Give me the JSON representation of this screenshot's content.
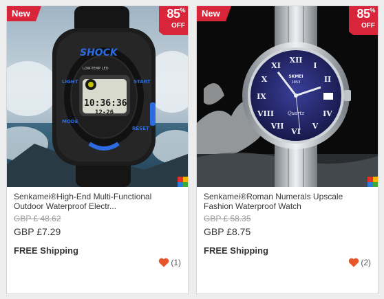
{
  "products": [
    {
      "badge_new": "New",
      "discount_pct": "85",
      "discount_sup": "%",
      "discount_word": "OFF",
      "title": "Senkamei®High-End Multi-Functional Outdoor Waterproof Electr...",
      "old_price": "GBP £ 48.62",
      "price": "GBP £7.29",
      "shipping": "FREE Shipping",
      "fav_count": "(1)",
      "watch_brand": "SHOCK",
      "watch_time": "10:36:36",
      "watch_date": "12-26",
      "watch_side_left": "LIGHT",
      "watch_side_right": "START",
      "watch_side_left2": "MODE",
      "watch_side_right2": "RESET",
      "watch_small": "LOW-TEMP LED"
    },
    {
      "badge_new": "New",
      "discount_pct": "85",
      "discount_sup": "%",
      "discount_word": "OFF",
      "title": "Senkamei®Roman Numerals Upscale Fashion Waterproof Watch",
      "old_price": "GBP £ 58.35",
      "price": "GBP £8.75",
      "shipping": "FREE Shipping",
      "fav_count": "(2)",
      "watch_brand": "SKMEI",
      "watch_year": "1853",
      "watch_quartz": "Quartz"
    }
  ],
  "colors": {
    "badge_red": "#d8253a",
    "heart": "#e8552b",
    "mark_tl": "#e0312b",
    "mark_tr": "#f6b300",
    "mark_bl": "#2d7cd6",
    "mark_br": "#3caa3c"
  },
  "icons": {
    "favorite": "heart-icon",
    "brand_mark": "four-square-logo-icon"
  }
}
